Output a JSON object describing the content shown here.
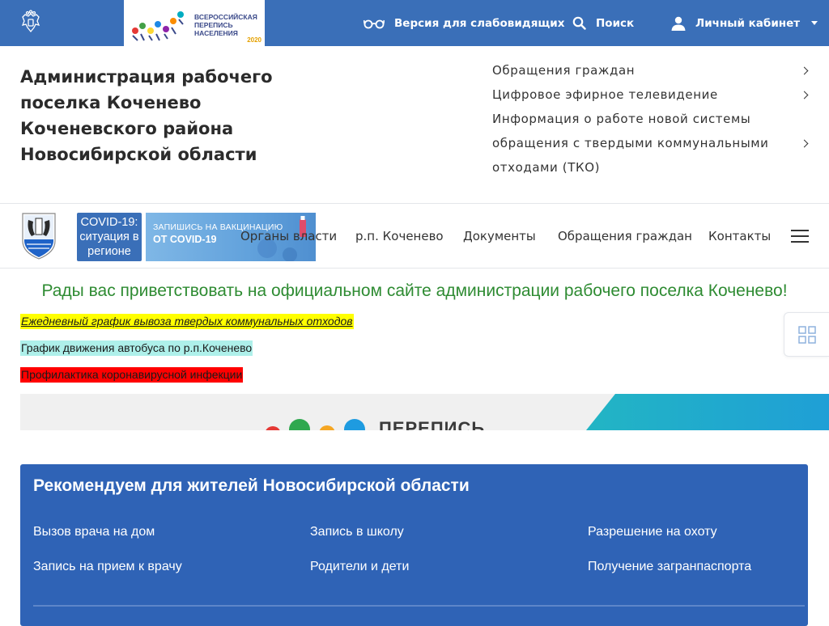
{
  "topbar": {
    "census_logo_text": "ВСЕРОССИЙСКАЯ ПЕРЕПИСЬ НАСЕЛЕНИЯ",
    "census_logo_year": "2020",
    "vision_label": "Версия для слабовидящих",
    "search_label": "Поиск",
    "cabinet_label": "Личный кабинет"
  },
  "header": {
    "site_title": "Администрация рабочего поселка Коченево Коченевского района Новосибирской области",
    "quick_links": [
      {
        "label": "Обращения граждан"
      },
      {
        "label": "Цифровое эфирное телевидение"
      },
      {
        "label": "Информация о работе новой системы обращения с твердыми коммунальными отходами (ТКО)"
      }
    ]
  },
  "navbar": {
    "covid_badge": "COVID-19: ситуация в регионе",
    "vacc_line1": "ЗАПИШИСЬ НА ВАКЦИНАЦИЮ",
    "vacc_line2": "ОТ COVID-19",
    "items": [
      {
        "label": "Органы власти"
      },
      {
        "label": "р.п. Коченево"
      },
      {
        "label": "Документы"
      },
      {
        "label": "Обращения граждан"
      },
      {
        "label": "Контакты"
      }
    ]
  },
  "content": {
    "welcome": "Рады вас приветствовать на официальном сайте администрации рабочего поселка Коченево!",
    "links": [
      {
        "label": "Ежедневный график вывоза твердых коммунальных отходов",
        "color": "#ffff00"
      },
      {
        "label": "График движения автобуса по р.п.Коченево",
        "color": "#aef0ea"
      },
      {
        "label": "Профилактика коронавирусной инфекции",
        "color": "#ff0000"
      }
    ],
    "banner_word": "ПЕРЕПИСЬ"
  },
  "recommend": {
    "title": "Рекомендуем для жителей Новосибирской области",
    "links": [
      {
        "label": "Вызов врача на дом"
      },
      {
        "label": "Запись в школу"
      },
      {
        "label": "Разрешение на охоту"
      },
      {
        "label": "Запись на прием к врачу"
      },
      {
        "label": "Родители и дети"
      },
      {
        "label": "Получение загранпаспорта"
      }
    ]
  },
  "colors": {
    "topbar": "#3a6fb8",
    "recommend_panel": "#2f63b6",
    "welcome_text": "#2e8b32"
  },
  "icons": [
    "russia-emblem-icon",
    "glasses-icon",
    "search-icon",
    "user-icon",
    "chevron-right-icon",
    "nso-emblem-icon",
    "menu-icon",
    "grid-icon"
  ]
}
